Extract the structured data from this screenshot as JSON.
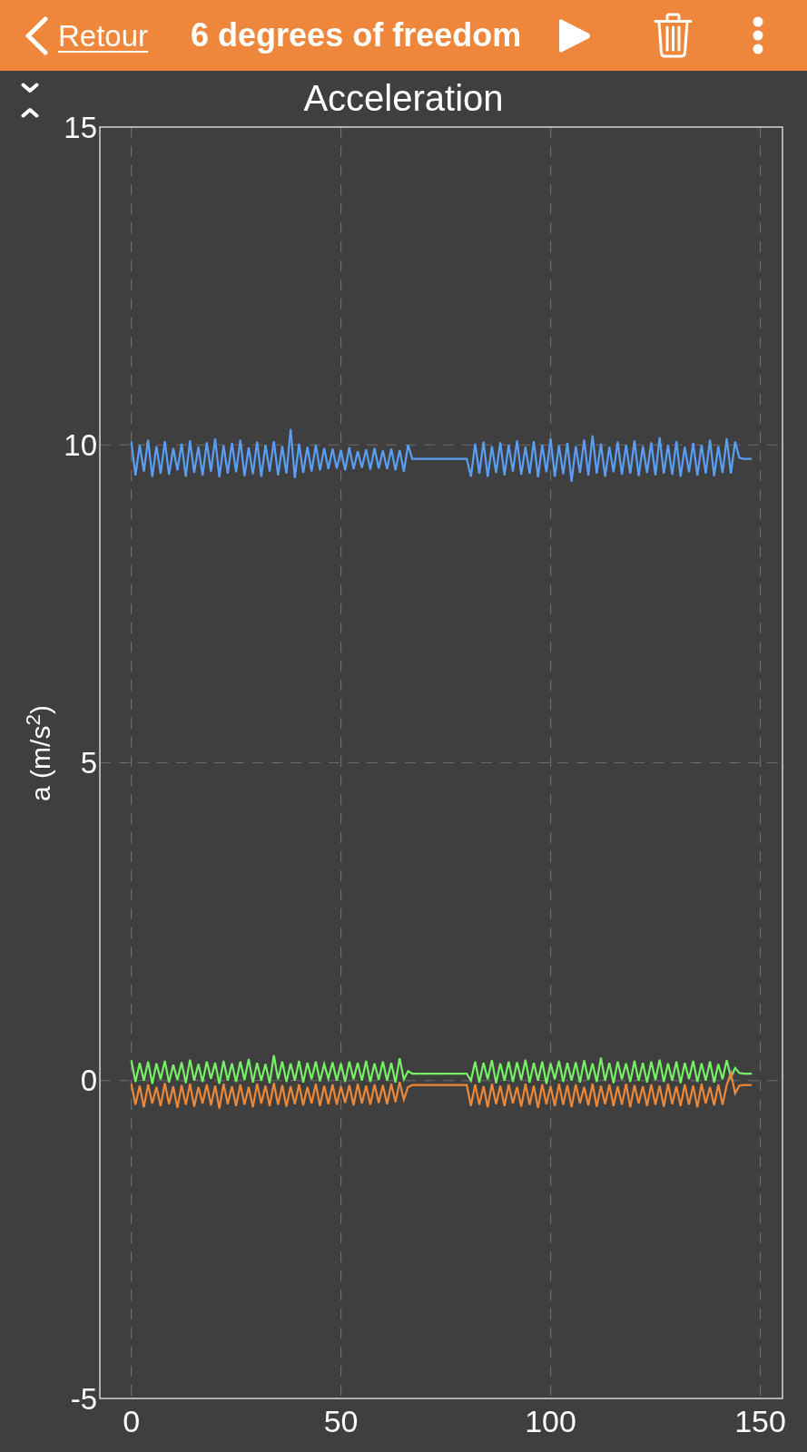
{
  "header": {
    "back_link": "Retour",
    "title": "6 degrees of freedom"
  },
  "panel": {
    "chart_data": {
      "type": "line",
      "title": "Acceleration",
      "ylabel": "a (m/s$^{2}$)",
      "xlim": [
        -7.5,
        155.3
      ],
      "ylim": [
        -5,
        15
      ],
      "xticks": [
        0,
        50,
        100,
        150
      ],
      "yticks": [
        -5,
        0,
        5,
        10,
        15
      ],
      "grid": true,
      "x": [
        0,
        1,
        2,
        3,
        4,
        5,
        6,
        7,
        8,
        9,
        10,
        11,
        12,
        13,
        14,
        15,
        16,
        17,
        18,
        19,
        20,
        21,
        22,
        23,
        24,
        25,
        26,
        27,
        28,
        29,
        30,
        31,
        32,
        33,
        34,
        35,
        36,
        37,
        38,
        39,
        40,
        41,
        42,
        43,
        44,
        45,
        46,
        47,
        48,
        49,
        50,
        51,
        52,
        53,
        54,
        55,
        56,
        57,
        58,
        59,
        60,
        61,
        62,
        63,
        64,
        65,
        66,
        67,
        68,
        69,
        70,
        71,
        72,
        73,
        74,
        75,
        76,
        77,
        78,
        79,
        80,
        81,
        82,
        83,
        84,
        85,
        86,
        87,
        88,
        89,
        90,
        91,
        92,
        93,
        94,
        95,
        96,
        97,
        98,
        99,
        100,
        101,
        102,
        103,
        104,
        105,
        106,
        107,
        108,
        109,
        110,
        111,
        112,
        113,
        114,
        115,
        116,
        117,
        118,
        119,
        120,
        121,
        122,
        123,
        124,
        125,
        126,
        127,
        128,
        129,
        130,
        131,
        132,
        133,
        134,
        135,
        136,
        137,
        138,
        139,
        140,
        141,
        142,
        143,
        144,
        145,
        146,
        147,
        148
      ],
      "series": [
        {
          "color": "#5a9ff5",
          "values": [
            10.05,
            9.52,
            10.0,
            9.58,
            10.08,
            9.5,
            9.98,
            9.55,
            10.06,
            9.53,
            9.95,
            9.6,
            10.02,
            9.5,
            10.07,
            9.56,
            9.97,
            9.52,
            10.04,
            9.58,
            10.1,
            9.49,
            9.99,
            9.55,
            10.03,
            9.57,
            10.08,
            9.51,
            9.96,
            9.54,
            10.05,
            9.5,
            10.0,
            9.58,
            10.06,
            9.52,
            9.98,
            9.55,
            10.25,
            9.48,
            10.02,
            9.56,
            9.97,
            9.58,
            10.0,
            9.6,
            9.95,
            9.62,
            9.94,
            9.63,
            9.92,
            9.6,
            9.96,
            9.62,
            9.9,
            9.64,
            9.93,
            9.61,
            9.95,
            9.63,
            9.91,
            9.62,
            9.94,
            9.6,
            9.92,
            9.58,
            10.0,
            9.78,
            9.78,
            9.78,
            9.78,
            9.78,
            9.78,
            9.78,
            9.78,
            9.78,
            9.78,
            9.78,
            9.78,
            9.78,
            9.78,
            9.5,
            10.02,
            9.55,
            10.05,
            9.5,
            9.98,
            9.56,
            10.04,
            9.52,
            10.0,
            9.58,
            10.07,
            9.53,
            9.97,
            9.55,
            10.06,
            9.49,
            10.0,
            9.57,
            10.1,
            9.5,
            9.99,
            9.54,
            10.03,
            9.42,
            9.98,
            9.56,
            10.08,
            9.52,
            10.15,
            9.55,
            10.02,
            9.5,
            9.97,
            9.57,
            10.05,
            9.53,
            10.0,
            9.55,
            10.07,
            9.51,
            9.98,
            9.56,
            10.04,
            9.52,
            10.12,
            9.55,
            10.0,
            9.53,
            10.06,
            9.5,
            9.97,
            9.57,
            10.03,
            9.52,
            10.0,
            9.55,
            10.08,
            9.51,
            9.98,
            9.56,
            10.1,
            9.55,
            10.05,
            9.8,
            9.78,
            9.78,
            9.78
          ]
        },
        {
          "color": "#76f064",
          "values": [
            0.32,
            -0.02,
            0.28,
            0.0,
            0.3,
            -0.05,
            0.27,
            0.02,
            0.31,
            -0.03,
            0.25,
            0.01,
            0.29,
            -0.04,
            0.33,
            0.0,
            0.26,
            -0.02,
            0.3,
            0.03,
            0.28,
            -0.05,
            0.31,
            0.0,
            0.27,
            -0.02,
            0.3,
            0.01,
            0.34,
            -0.03,
            0.28,
            0.0,
            0.26,
            -0.04,
            0.4,
            0.02,
            0.3,
            -0.02,
            0.27,
            0.0,
            0.31,
            -0.03,
            0.28,
            0.02,
            0.3,
            -0.01,
            0.26,
            0.03,
            0.29,
            0.0,
            0.27,
            -0.02,
            0.3,
            0.02,
            0.28,
            0.0,
            0.31,
            -0.02,
            0.27,
            0.01,
            0.3,
            0.0,
            0.28,
            -0.03,
            0.35,
            0.02,
            0.15,
            0.11,
            0.11,
            0.11,
            0.11,
            0.11,
            0.11,
            0.11,
            0.11,
            0.11,
            0.11,
            0.11,
            0.11,
            0.11,
            0.11,
            0.0,
            0.3,
            -0.03,
            0.28,
            0.02,
            0.32,
            -0.04,
            0.27,
            0.0,
            0.3,
            -0.02,
            0.29,
            0.01,
            0.33,
            -0.03,
            0.28,
            0.0,
            0.3,
            -0.05,
            0.27,
            0.02,
            0.31,
            -0.02,
            0.28,
            0.0,
            0.29,
            -0.03,
            0.32,
            0.01,
            0.27,
            -0.02,
            0.36,
            0.0,
            0.28,
            -0.04,
            0.3,
            0.02,
            0.27,
            -0.02,
            0.31,
            0.0,
            0.28,
            -0.03,
            0.3,
            0.01,
            0.33,
            -0.02,
            0.27,
            0.0,
            0.3,
            -0.04,
            0.28,
            0.02,
            0.31,
            -0.02,
            0.27,
            0.0,
            0.3,
            -0.03,
            0.26,
            0.02,
            0.32,
            0.05,
            0.2,
            0.12,
            0.11,
            0.11,
            0.11
          ]
        },
        {
          "color": "#ec8839",
          "values": [
            -0.05,
            -0.38,
            -0.08,
            -0.42,
            -0.06,
            -0.36,
            -0.1,
            -0.4,
            -0.04,
            -0.37,
            -0.09,
            -0.43,
            -0.07,
            -0.38,
            -0.05,
            -0.41,
            -0.1,
            -0.36,
            -0.06,
            -0.39,
            -0.08,
            -0.44,
            -0.05,
            -0.37,
            -0.09,
            -0.4,
            -0.06,
            -0.38,
            -0.1,
            -0.42,
            -0.05,
            -0.36,
            -0.08,
            -0.4,
            -0.04,
            -0.38,
            -0.07,
            -0.41,
            -0.09,
            -0.37,
            -0.06,
            -0.39,
            -0.1,
            -0.36,
            -0.05,
            -0.4,
            -0.08,
            -0.37,
            -0.06,
            -0.38,
            -0.09,
            -0.35,
            -0.07,
            -0.39,
            -0.05,
            -0.36,
            -0.08,
            -0.38,
            -0.06,
            -0.35,
            -0.07,
            -0.37,
            -0.05,
            -0.34,
            -0.02,
            -0.3,
            -0.1,
            -0.07,
            -0.07,
            -0.07,
            -0.07,
            -0.07,
            -0.07,
            -0.07,
            -0.07,
            -0.07,
            -0.07,
            -0.07,
            -0.07,
            -0.07,
            -0.07,
            -0.4,
            -0.06,
            -0.38,
            -0.09,
            -0.42,
            -0.05,
            -0.37,
            -0.08,
            -0.4,
            -0.06,
            -0.36,
            -0.1,
            -0.41,
            -0.05,
            -0.38,
            -0.08,
            -0.43,
            -0.06,
            -0.37,
            -0.09,
            -0.4,
            -0.05,
            -0.38,
            -0.07,
            -0.42,
            -0.06,
            -0.36,
            -0.1,
            -0.39,
            -0.05,
            -0.41,
            -0.08,
            -0.37,
            -0.06,
            -0.4,
            -0.09,
            -0.38,
            -0.05,
            -0.42,
            -0.07,
            -0.36,
            -0.09,
            -0.4,
            -0.06,
            -0.38,
            -0.08,
            -0.41,
            -0.05,
            -0.37,
            -0.09,
            -0.4,
            -0.06,
            -0.38,
            -0.08,
            -0.42,
            -0.05,
            -0.36,
            -0.1,
            -0.39,
            -0.06,
            -0.38,
            -0.07,
            0.12,
            -0.2,
            -0.08,
            -0.07,
            -0.07,
            -0.07
          ]
        }
      ]
    }
  }
}
